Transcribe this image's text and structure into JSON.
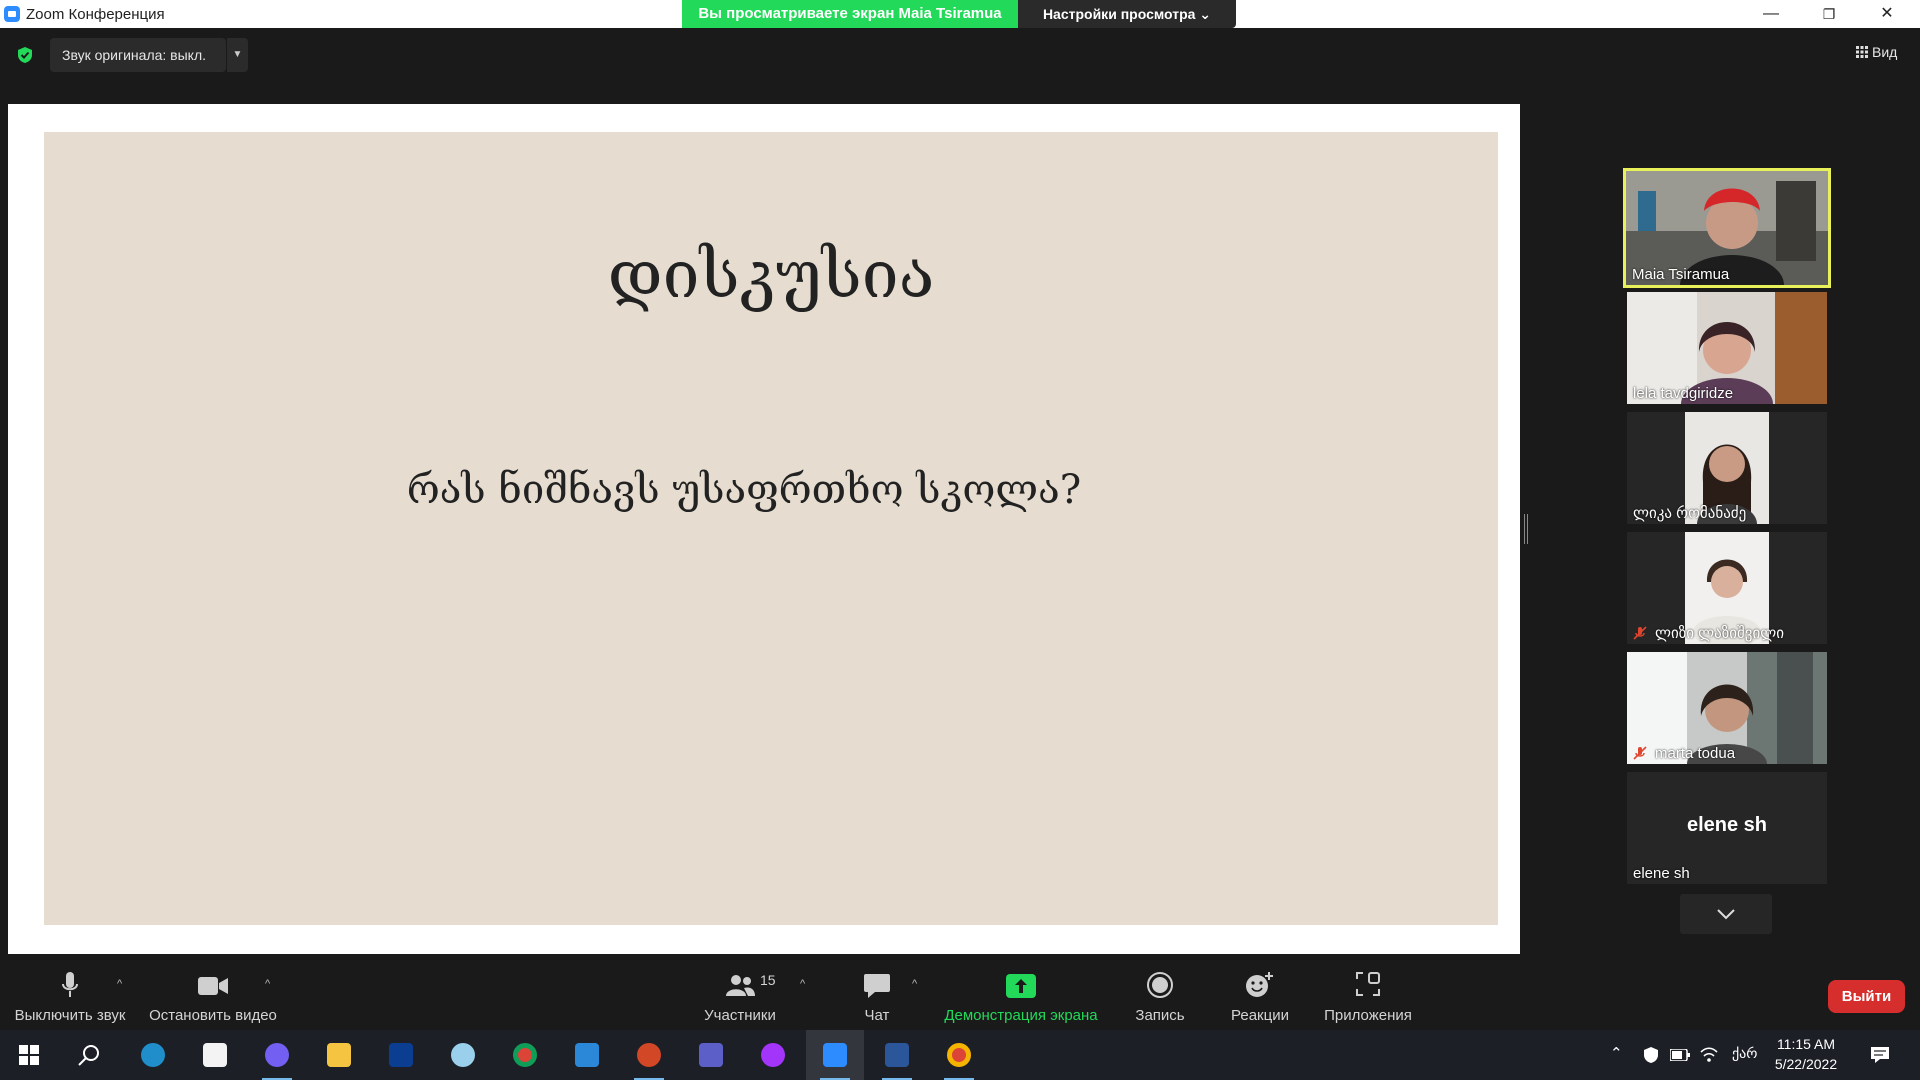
{
  "window": {
    "title": "Zoom Конференция",
    "viewing_banner": "Вы просматриваете экран Maia Tsiramua",
    "view_settings": "Настройки просмотра ⌄",
    "controls": {
      "minimize": "—",
      "restore": "❐",
      "close": "✕"
    }
  },
  "topbar": {
    "audio_label": "Звук оригинала: выкл.",
    "audio_dropdown": "▼",
    "view_label": "Вид"
  },
  "slide": {
    "title": "დისკუსია",
    "question": "რას ნიშნავს უსაფრთხო სკოლა?"
  },
  "gallery": [
    {
      "name": "Maia Tsiramua",
      "muted": false,
      "active_speaker": true
    },
    {
      "name": "lela tavdgiridze",
      "muted": false
    },
    {
      "name": "ლიკა რომანაძე",
      "muted": false
    },
    {
      "name": "ლიზი ლაზიშვილი",
      "muted": true
    },
    {
      "name": "marta todua",
      "muted": true
    },
    {
      "name": "elene sh",
      "center_name": "elene sh",
      "muted": false
    }
  ],
  "toolbar": {
    "mute_label": "Выключить звук",
    "video_label": "Остановить видео",
    "participants_label": "Участники",
    "participants_count": "15",
    "chat_label": "Чат",
    "share_label": "Демонстрация экрана",
    "record_label": "Запись",
    "reactions_label": "Реакции",
    "apps_label": "Приложения",
    "leave_label": "Выйти",
    "caret": "^"
  },
  "taskbar": {
    "time": "11:15 AM",
    "date": "5/22/2022",
    "language": "ქარ",
    "apps": [
      "start",
      "search",
      "edge",
      "store",
      "viber",
      "explorer",
      "booking",
      "paint",
      "chrome",
      "mail",
      "powerpoint",
      "teams",
      "messenger",
      "zoom",
      "word",
      "chrome"
    ]
  },
  "colors": {
    "banner_green": "#23d959",
    "share_green": "#23d959",
    "leave_red": "#d62d2d",
    "active_speaker": "#e8f05a",
    "slide_bg": "#e6ddd0"
  }
}
